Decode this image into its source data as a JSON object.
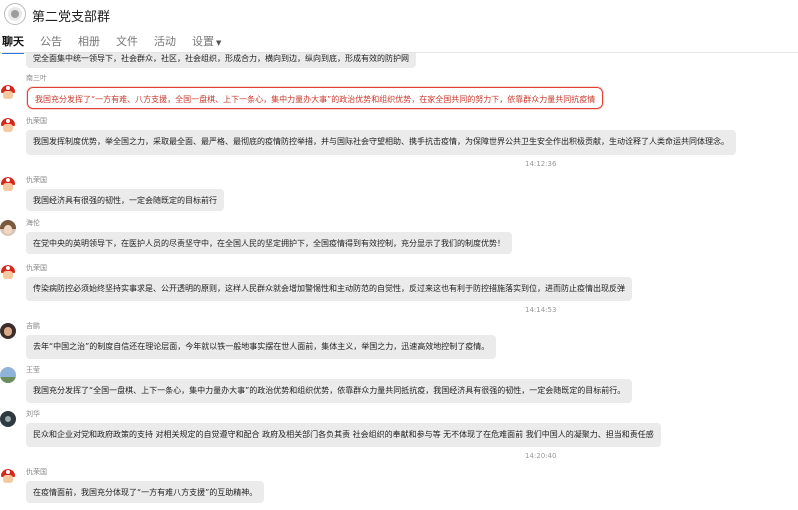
{
  "header": {
    "group_name": "第二党支部群",
    "tabs": [
      {
        "label": "聊天"
      },
      {
        "label": "公告"
      },
      {
        "label": "相册"
      },
      {
        "label": "文件"
      },
      {
        "label": "活动"
      },
      {
        "label": "设置"
      }
    ]
  },
  "messages": [
    {
      "text": "党全面集中统一领导下，社会群众，社区，社会组织，形成合力，横向到边，纵向到底，形成有效的防护网"
    },
    {
      "sender": "南三叶",
      "text": "我国充分发挥了“一方有难、八方支援，全国一盘棋、上下一条心，集中力量办大事”的政治优势和组织优势，在家全国共同的努力下，依靠群众力量共同抗疫情",
      "avatar": "mario-icon"
    },
    {
      "sender": "仇荣国",
      "text": "我国发挥制度优势，举全国之力，采取最全面、最严格、最彻底的疫情防控举措，并与国际社会守望相助、携手抗击疫情，为保障世界公共卫生安全作出积极贡献，生动诠释了人类命运共同体理念。"
    },
    {
      "sender": "仇荣国",
      "text": "我国经济具有很强的韧性，一定会随既定的目标前行"
    },
    {
      "sender": "海伦",
      "text": "在党中央的英明领导下，在医护人员的尽责坚守中，在全国人民的坚定拥护下，全国疫情得到有效控制，充分显示了我们的制度优势！"
    },
    {
      "sender": "仇荣国",
      "text": "传染病防控必须始终坚持实事求是、公开透明的原则，这样人民群众就会增加警惕性和主动防范的自觉性，反过来这也有利于防控措施落实到位，进而防止疫情出现反弹"
    },
    {
      "sender": "吉鹏",
      "text": "去年“中国之治”的制度自信还在理论层面，今年就以铁一般地事实摆在世人面前，集体主义，举国之力，迅速高效地控制了疫情。"
    },
    {
      "sender": "王莹",
      "text": "我国充分发挥了“全国一盘棋、上下一条心，集中力量办大事”的政治优势和组织优势，依靠群众力量共同抵抗疫，我国经济具有很强的韧性，一定会随既定的目标前行。"
    },
    {
      "sender": "刘华",
      "text": "民众和企业对党和政府政策的支持  对相关规定的自觉遵守和配合  政府及相关部门各负其责  社会组织的奉献和参与等  无不体现了在危难面前  我们中国人的凝聚力、担当和责任感"
    },
    {
      "sender": "仇荣国",
      "text": "在疫情面前，我国充分体现了“一方有难八方支援”的互助精神。"
    }
  ],
  "timestamps": [
    "14:12:36",
    "14:14:53",
    "14:20:40"
  ],
  "colors": {
    "accent": "#2c7be5",
    "highlight_border": "#e04135",
    "highlight_text": "#c7382c",
    "bubble_bg": "#ebebeb"
  }
}
